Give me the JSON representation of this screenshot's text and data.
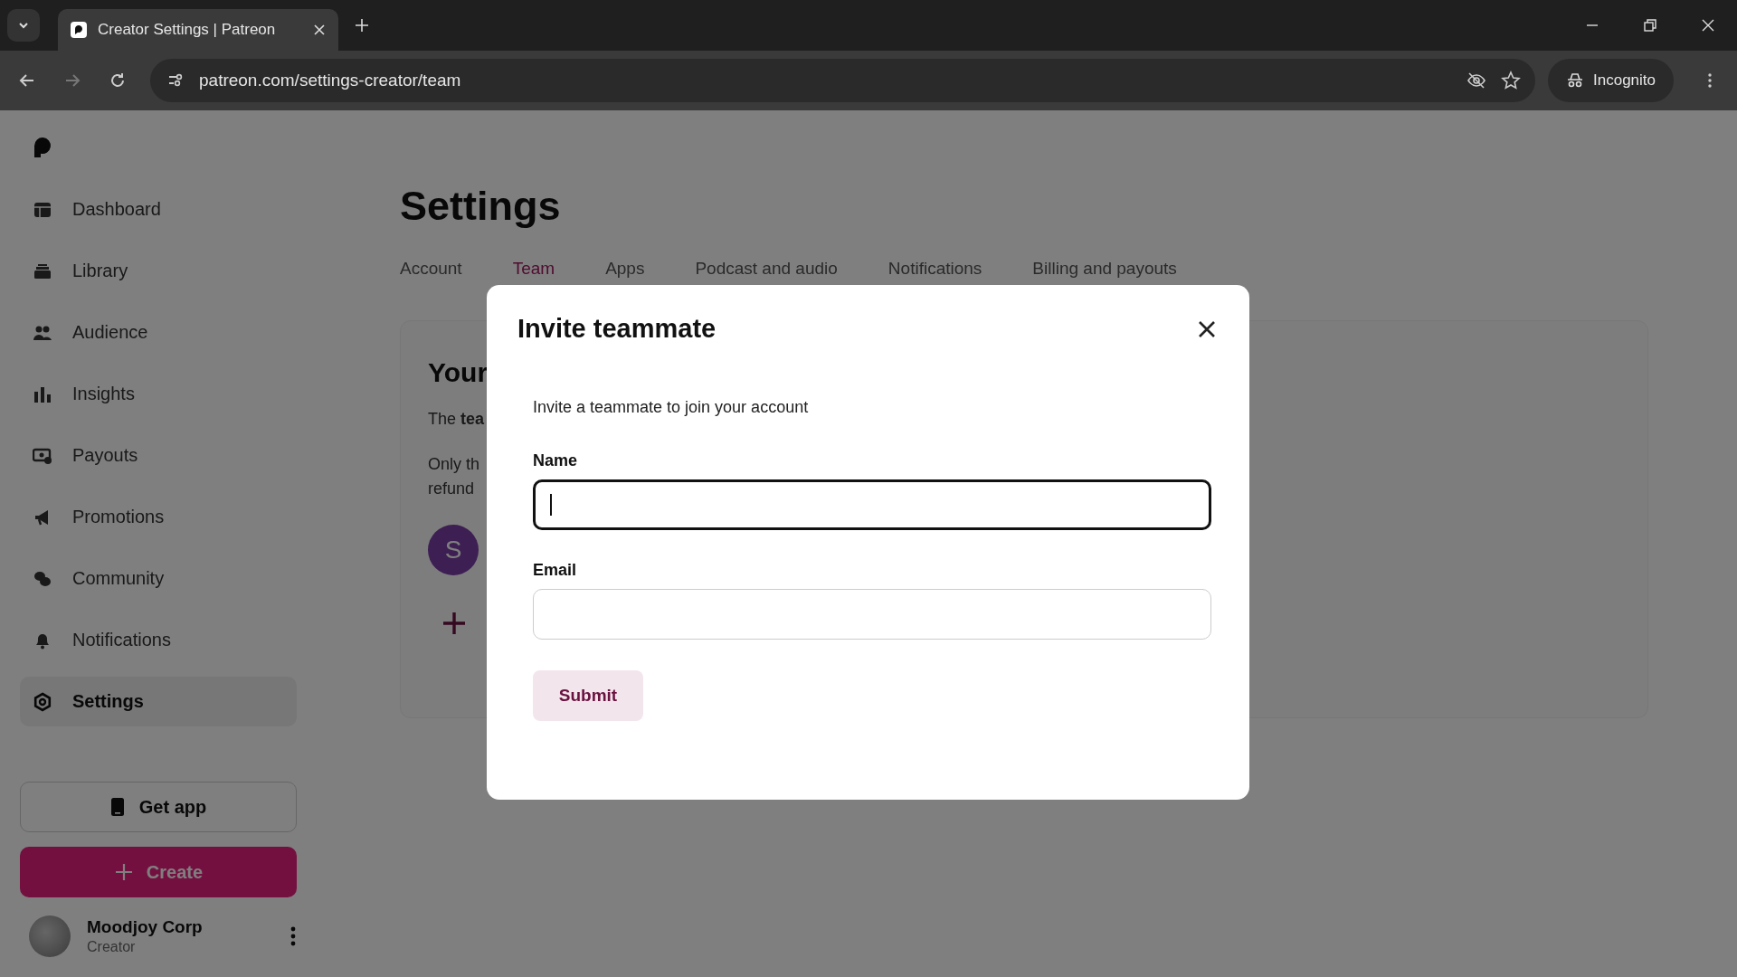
{
  "browser": {
    "tab_title": "Creator Settings | Patreon",
    "url": "patreon.com/settings-creator/team",
    "profile_label": "Incognito"
  },
  "sidebar": {
    "items": [
      {
        "label": "Dashboard",
        "selected": false
      },
      {
        "label": "Library",
        "selected": false
      },
      {
        "label": "Audience",
        "selected": false
      },
      {
        "label": "Insights",
        "selected": false
      },
      {
        "label": "Payouts",
        "selected": false
      },
      {
        "label": "Promotions",
        "selected": false
      },
      {
        "label": "Community",
        "selected": false
      },
      {
        "label": "Notifications",
        "selected": false
      },
      {
        "label": "Settings",
        "selected": true
      }
    ],
    "get_app_button": "Get app",
    "create_button": "Create",
    "account": {
      "name": "Moodjoy Corp",
      "role": "Creator"
    }
  },
  "page": {
    "title": "Settings",
    "tabs": [
      {
        "label": "Account",
        "selected": false
      },
      {
        "label": "Team",
        "selected": true
      },
      {
        "label": "Apps",
        "selected": false
      },
      {
        "label": "Podcast and audio",
        "selected": false
      },
      {
        "label": "Notifications",
        "selected": false
      },
      {
        "label": "Billing and payouts",
        "selected": false
      }
    ],
    "card": {
      "heading": "Your",
      "line_1": "The **tea**",
      "line_2": "Only th",
      "line_3": "refund",
      "avatar_letter": "S"
    }
  },
  "modal": {
    "title": "Invite teammate",
    "description": "Invite a teammate to join your account",
    "fields": [
      {
        "label": "Name",
        "focused": true
      },
      {
        "label": "Email",
        "focused": false
      }
    ],
    "submit_button": "Submit"
  }
}
